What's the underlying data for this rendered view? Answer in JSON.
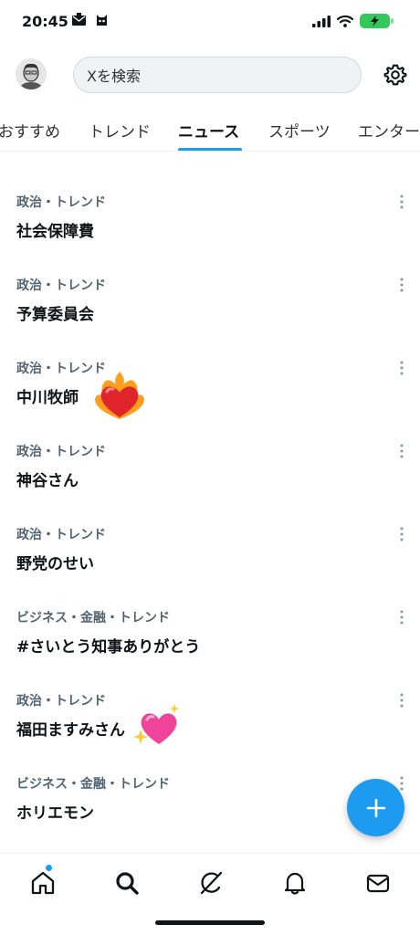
{
  "status_bar": {
    "time": "20:45"
  },
  "header": {
    "search_placeholder": "Xを検索"
  },
  "tabs": [
    {
      "label": "おすすめ",
      "active": false
    },
    {
      "label": "トレンド",
      "active": false
    },
    {
      "label": "ニュース",
      "active": true
    },
    {
      "label": "スポーツ",
      "active": false
    },
    {
      "label": "エンター",
      "active": false
    }
  ],
  "trends": [
    {
      "meta": "政治・トレンド",
      "title": "社会保障費"
    },
    {
      "meta": "政治・トレンド",
      "title": "予算委員会"
    },
    {
      "meta": "政治・トレンド",
      "title": "中川牧師"
    },
    {
      "meta": "政治・トレンド",
      "title": "神谷さん"
    },
    {
      "meta": "政治・トレンド",
      "title": "野党のせい"
    },
    {
      "meta": "ビジネス・金融・トレンド",
      "title": "#さいとう知事ありがとう"
    },
    {
      "meta": "政治・トレンド",
      "title": "福田ますみさん"
    },
    {
      "meta": "ビジネス・金融・トレンド",
      "title": "ホリエモン"
    }
  ],
  "icons": {
    "battery_color": "#34c759",
    "accent": "#1d9bf0"
  }
}
